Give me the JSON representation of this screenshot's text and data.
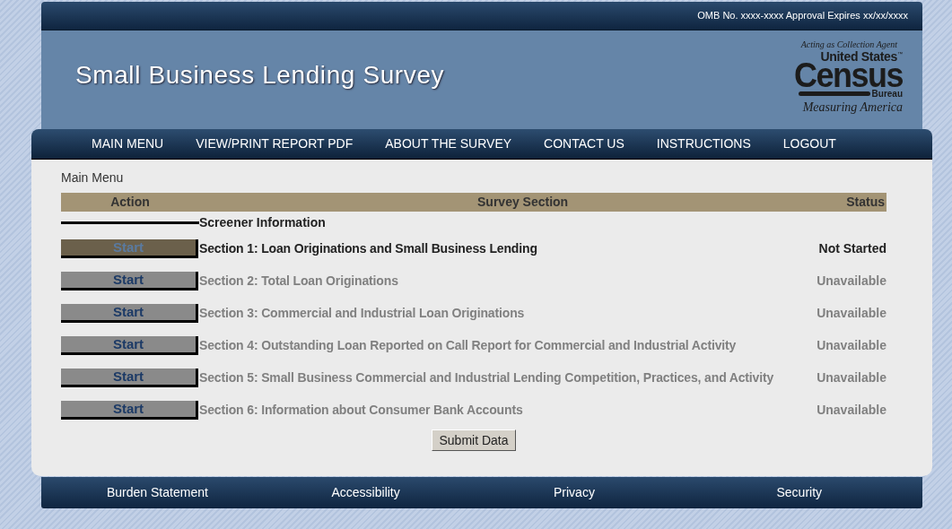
{
  "omb_notice": "OMB No. xxxx-xxxx Approval Expires xx/xx/xxxx",
  "site_title": "Small Business Lending Survey",
  "logo": {
    "tagline_top": "Acting as Collection Agent",
    "line1": "United States",
    "trademark": "™",
    "line2": "Census",
    "line3": "Bureau",
    "tagline_bottom": "Measuring America"
  },
  "nav": [
    "MAIN MENU",
    "VIEW/PRINT REPORT PDF",
    "ABOUT THE SURVEY",
    "CONTACT US",
    "INSTRUCTIONS",
    "LOGOUT"
  ],
  "breadcrumb": "Main Menu",
  "table": {
    "columns": [
      "Action",
      "Survey Section",
      "Status"
    ],
    "rows": [
      {
        "kind": "heading",
        "title": "Screener Information"
      },
      {
        "kind": "section",
        "button": "Start",
        "title": "Section 1: Loan Originations and Small Business Lending",
        "status": "Not Started",
        "disabled": false
      },
      {
        "kind": "section",
        "button": "Start",
        "title": "Section 2: Total Loan Originations",
        "status": "Unavailable",
        "disabled": true
      },
      {
        "kind": "section",
        "button": "Start",
        "title": "Section 3: Commercial and Industrial Loan Originations",
        "status": "Unavailable",
        "disabled": true
      },
      {
        "kind": "section",
        "button": "Start",
        "title": "Section 4: Outstanding Loan Reported on Call Report for Commercial and Industrial Activity",
        "status": "Unavailable",
        "disabled": true
      },
      {
        "kind": "section",
        "button": "Start",
        "title": "Section 5: Small Business Commercial and Industrial Lending Competition, Practices, and Activity",
        "status": "Unavailable",
        "disabled": true
      },
      {
        "kind": "section",
        "button": "Start",
        "title": "Section 6: Information about Consumer Bank Accounts",
        "status": "Unavailable",
        "disabled": true
      }
    ]
  },
  "submit_button": "Submit Data",
  "footer_links": [
    "Burden Statement",
    "Accessibility",
    "Privacy",
    "Security"
  ]
}
